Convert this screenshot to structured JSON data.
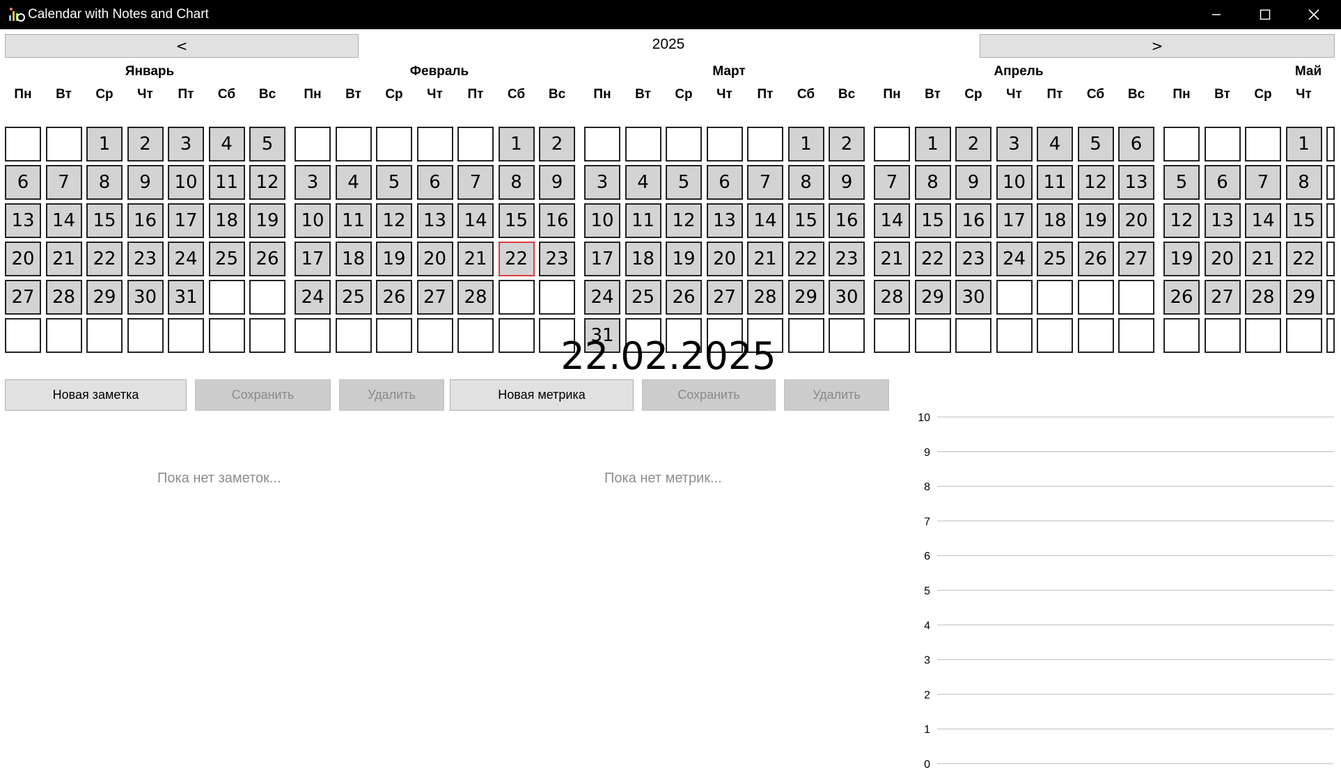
{
  "window": {
    "title": "Calendar with Notes and Chart",
    "controls": [
      "minimize",
      "maximize",
      "close"
    ]
  },
  "nav": {
    "prev_label": "<",
    "year": "2025",
    "next_label": ">"
  },
  "weekdays": [
    "Пн",
    "Вт",
    "Ср",
    "Чт",
    "Пт",
    "Сб",
    "Вс"
  ],
  "months": [
    {
      "name": "Январь",
      "rows": [
        [
          "",
          "",
          "1",
          "2",
          "3",
          "4",
          "5"
        ],
        [
          "6",
          "7",
          "8",
          "9",
          "10",
          "11",
          "12"
        ],
        [
          "13",
          "14",
          "15",
          "16",
          "17",
          "18",
          "19"
        ],
        [
          "20",
          "21",
          "22",
          "23",
          "24",
          "25",
          "26"
        ],
        [
          "27",
          "28",
          "29",
          "30",
          "31",
          "",
          ""
        ],
        [
          "",
          "",
          "",
          "",
          "",
          "",
          ""
        ]
      ]
    },
    {
      "name": "Февраль",
      "rows": [
        [
          "",
          "",
          "",
          "",
          "",
          "1",
          "2"
        ],
        [
          "3",
          "4",
          "5",
          "6",
          "7",
          "8",
          "9"
        ],
        [
          "10",
          "11",
          "12",
          "13",
          "14",
          "15",
          "16"
        ],
        [
          "17",
          "18",
          "19",
          "20",
          "21",
          "22",
          "23"
        ],
        [
          "24",
          "25",
          "26",
          "27",
          "28",
          "",
          ""
        ],
        [
          "",
          "",
          "",
          "",
          "",
          "",
          ""
        ]
      ]
    },
    {
      "name": "Март",
      "rows": [
        [
          "",
          "",
          "",
          "",
          "",
          "1",
          "2"
        ],
        [
          "3",
          "4",
          "5",
          "6",
          "7",
          "8",
          "9"
        ],
        [
          "10",
          "11",
          "12",
          "13",
          "14",
          "15",
          "16"
        ],
        [
          "17",
          "18",
          "19",
          "20",
          "21",
          "22",
          "23"
        ],
        [
          "24",
          "25",
          "26",
          "27",
          "28",
          "29",
          "30"
        ],
        [
          "31",
          "",
          "",
          "",
          "",
          "",
          ""
        ]
      ]
    },
    {
      "name": "Апрель",
      "rows": [
        [
          "",
          "1",
          "2",
          "3",
          "4",
          "5",
          "6"
        ],
        [
          "7",
          "8",
          "9",
          "10",
          "11",
          "12",
          "13"
        ],
        [
          "14",
          "15",
          "16",
          "17",
          "18",
          "19",
          "20"
        ],
        [
          "21",
          "22",
          "23",
          "24",
          "25",
          "26",
          "27"
        ],
        [
          "28",
          "29",
          "30",
          "",
          "",
          "",
          ""
        ],
        [
          "",
          "",
          "",
          "",
          "",
          "",
          ""
        ]
      ]
    },
    {
      "name": "Май",
      "rows": [
        [
          "",
          "",
          "",
          "1",
          "",
          "",
          ""
        ],
        [
          "5",
          "6",
          "7",
          "8",
          "",
          "",
          ""
        ],
        [
          "12",
          "13",
          "14",
          "15",
          "",
          "",
          ""
        ],
        [
          "19",
          "20",
          "21",
          "22",
          "",
          "",
          ""
        ],
        [
          "26",
          "27",
          "28",
          "29",
          "",
          "",
          ""
        ],
        [
          "",
          "",
          "",
          "",
          "",
          "",
          ""
        ]
      ]
    }
  ],
  "selected": {
    "month": "Февраль",
    "day": "22"
  },
  "selected_date": "22.02.2025",
  "notes": {
    "new_label": "Новая заметка",
    "save_label": "Сохранить",
    "delete_label": "Удалить",
    "empty_text": "Пока нет заметок..."
  },
  "metrics": {
    "new_label": "Новая метрика",
    "save_label": "Сохранить",
    "delete_label": "Удалить",
    "empty_text": "Пока нет метрик..."
  },
  "colors": {
    "filled_day": "#d3d3d3",
    "selected_border": "#e23b3b",
    "disabled_text": "#8a8a8a"
  },
  "chart_data": {
    "type": "line",
    "title": "",
    "xlabel": "",
    "ylabel": "",
    "ylim": [
      0,
      10
    ],
    "yticks": [
      "0",
      "1",
      "2",
      "3",
      "4",
      "5",
      "6",
      "7",
      "8",
      "9",
      "10"
    ],
    "grid": true,
    "series": []
  }
}
